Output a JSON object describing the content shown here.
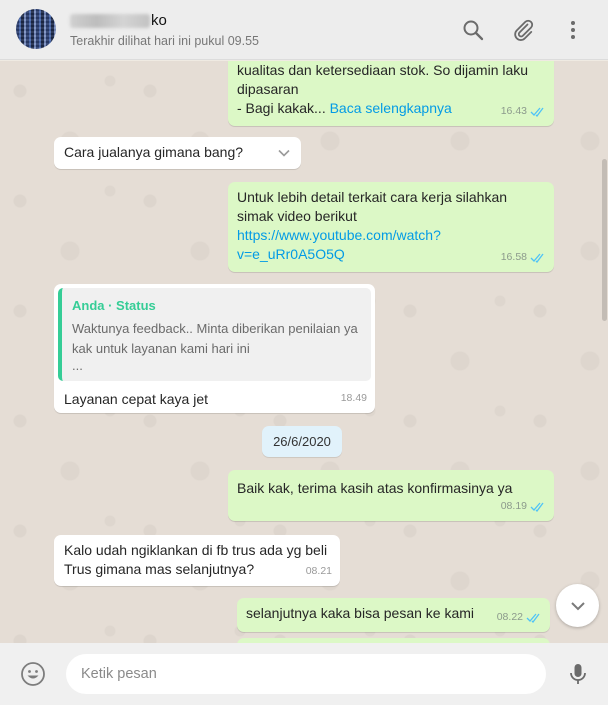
{
  "header": {
    "contact_name_visible": "ko",
    "last_seen": "Terakhir dilihat hari ini pukul 09.55"
  },
  "messages": {
    "m1": {
      "line1": "kualitas dan ketersediaan stok. So dijamin laku",
      "line2": "dipasaran",
      "line3_prefix": "- Bagi kakak... ",
      "read_more": "Baca selengkapnya",
      "time": "16.43"
    },
    "m2": {
      "text": "Cara jualanya gimana bang?"
    },
    "m3": {
      "line1": "Untuk lebih detail terkait cara kerja silahkan",
      "line2": "simak video berikut",
      "link_line1": "https://www.youtube.com/watch?",
      "link_line2": "v=e_uRr0A5O5Q",
      "time": "16.58"
    },
    "m4": {
      "quote_author": "Anda · Status",
      "quote_line1": "Waktunya feedback.. Minta diberikan penilaian ya",
      "quote_line2": "kak untuk layanan kami hari ini",
      "quote_line3": "...",
      "text": "Layanan cepat kaya jet",
      "time": "18.49"
    },
    "date_divider": "26/6/2020",
    "m5": {
      "text": "Baik kak, terima kasih atas konfirmasinya ya",
      "time": "08.19"
    },
    "m6": {
      "line1": "Kalo udah ngiklankan di fb trus ada yg beli",
      "line2": "Trus gimana mas selanjutnya?",
      "time": "08.21"
    },
    "m7": {
      "text": "selanjutnya kaka bisa pesan ke kami",
      "time": "08.22"
    }
  },
  "footer": {
    "input_placeholder": "Ketik pesan"
  },
  "colors": {
    "outgoing_bubble": "#dcf8c6",
    "incoming_bubble": "#ffffff",
    "link": "#039be5",
    "read_ticks": "#4fc3f7",
    "quote_accent": "#35cd96",
    "date_pill": "#e1f2fb"
  },
  "icons": {
    "search": "search-icon",
    "attach": "paperclip-icon",
    "menu": "kebab-menu-icon",
    "emoji": "emoji-icon",
    "mic": "microphone-icon",
    "scroll": "chevron-down-icon",
    "ticks": "double-check-icon"
  }
}
